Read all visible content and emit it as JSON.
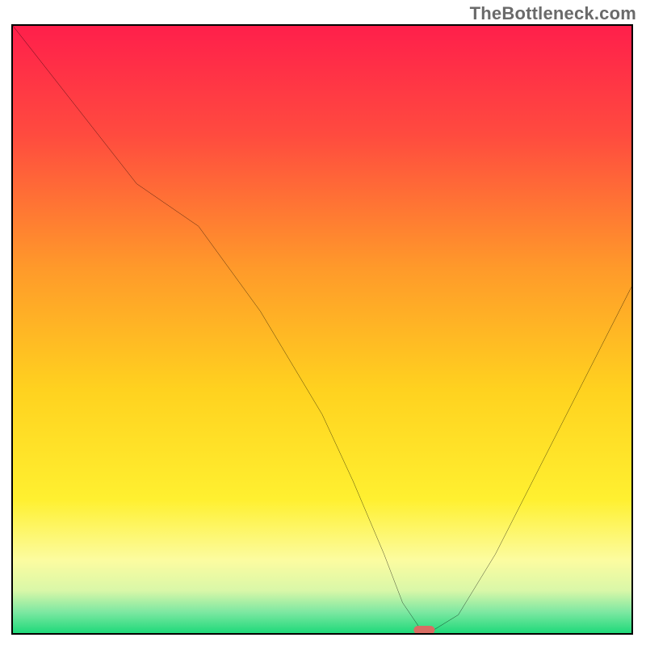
{
  "watermark": "TheBottleneck.com",
  "chart_data": {
    "type": "line",
    "title": "",
    "xlabel": "",
    "ylabel": "",
    "xlim": [
      0,
      100
    ],
    "ylim": [
      0,
      100
    ],
    "grid": false,
    "legend": "none",
    "series": [
      {
        "name": "bottleneck-curve",
        "x": [
          0,
          10,
          20,
          30,
          40,
          50,
          55,
          60,
          63,
          66,
          68,
          72,
          78,
          85,
          92,
          100
        ],
        "y": [
          100,
          87,
          74,
          67,
          53,
          36,
          25,
          13,
          5,
          0.5,
          0.5,
          3,
          13,
          27,
          41,
          57
        ]
      }
    ],
    "annotations": [
      {
        "name": "optimal-marker",
        "x": 66.5,
        "y": 0.5,
        "shape": "pill",
        "color": "#d96d63"
      }
    ],
    "gradient_stops": [
      {
        "offset": 0.0,
        "color": "#ff1f4b"
      },
      {
        "offset": 0.18,
        "color": "#ff4b3f"
      },
      {
        "offset": 0.4,
        "color": "#ff9a2a"
      },
      {
        "offset": 0.6,
        "color": "#ffd21f"
      },
      {
        "offset": 0.78,
        "color": "#fff030"
      },
      {
        "offset": 0.88,
        "color": "#fcfca0"
      },
      {
        "offset": 0.93,
        "color": "#d9f7a8"
      },
      {
        "offset": 0.965,
        "color": "#7ee8a2"
      },
      {
        "offset": 1.0,
        "color": "#1fd97a"
      }
    ]
  }
}
